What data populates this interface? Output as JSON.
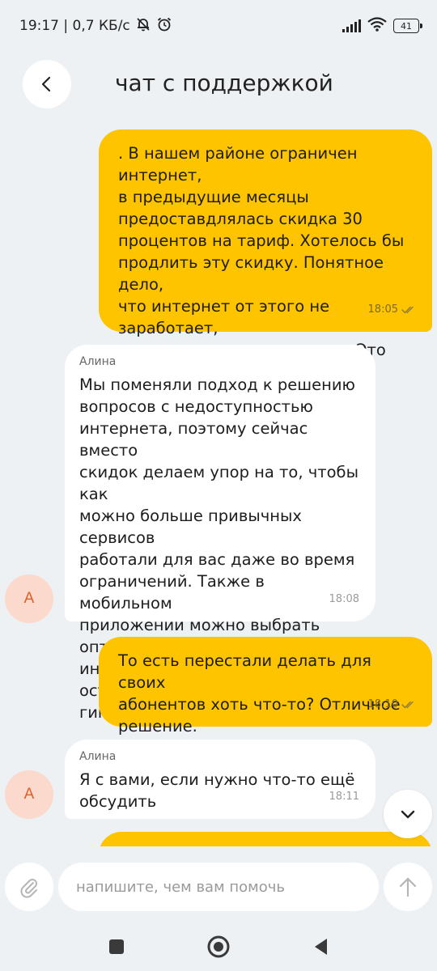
{
  "status_bar": {
    "time_speed": "19:17 | 0,7 КБ/с",
    "battery": "41"
  },
  "header": {
    "title": "чат с поддержкой"
  },
  "messages": [
    {
      "direction": "out",
      "text": ". В нашем районе ограничен интернет,\nв предыдущие месяцы\nпредоставдлялась скидка 30\nпроцентов на тариф. Хотелось бы\nпродлить эту скидку. Понятное дело,\nчто интернет от этого не заработает,\nно хоть какое-то утешение. Это\nвозможно?",
      "time": "18:05"
    },
    {
      "direction": "in",
      "sender": "Алина",
      "avatar": "А",
      "text": "Мы поменяли подход к решению\nвопросов с недоступностью\nинтернета, поэтому сейчас вместо\nскидок делаем упор на то, чтобы как\nможно больше привычных сервисов\nработали для вас даже во время\nограничений. Также в мобильном\nприложении можно выбрать\nоптимальное сочетание минут,\nинтернет и смс, если у вас остаются\nгигабайты из-за ограничения",
      "time": "18:08"
    },
    {
      "direction": "out",
      "text": "То есть перестали делать для своих\nабонентов хоть что-то? Отличное\nрешение.",
      "time": "18:10"
    },
    {
      "direction": "in",
      "sender": "Алина",
      "avatar": "А",
      "text": "Я с вами, если нужно что-то ещё\nобсудить",
      "time": "18:11"
    }
  ],
  "composer": {
    "placeholder": "напишите, чем вам помочь"
  },
  "colors": {
    "outgoing_bubble": "#ffc400",
    "incoming_bubble": "#ffffff",
    "background": "#eef1f4",
    "avatar_bg": "#fbd9cc",
    "avatar_text": "#d9622b"
  }
}
